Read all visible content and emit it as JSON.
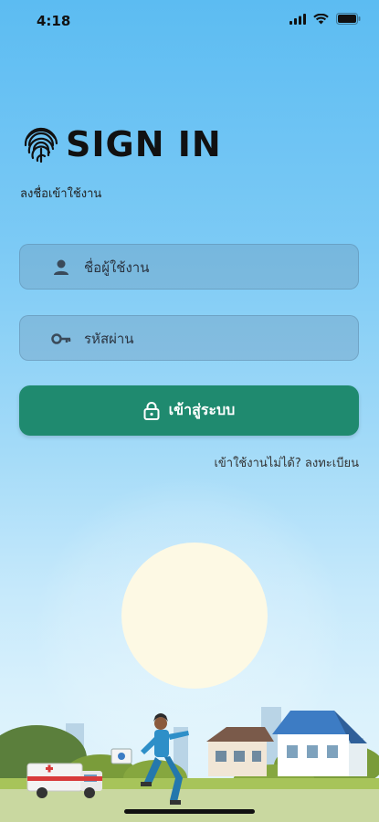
{
  "status_bar": {
    "time": "4:18"
  },
  "header": {
    "title": "SIGN IN",
    "subtitle": "ลงชื่อเข้าใช้งาน"
  },
  "form": {
    "username_placeholder": "ชื่อผู้ใช้งาน",
    "password_placeholder": "รหัสผ่าน",
    "submit_label": "เข้าสู่ระบบ"
  },
  "register": {
    "prompt": "เข้าใช้งานไม่ได้?",
    "link": "ลงทะเบียน"
  },
  "icons": {
    "user": "user-icon",
    "password": "key-icon",
    "submit": "lock-icon",
    "brand": "fingerprint-icon"
  },
  "colors": {
    "primary_button": "#1f8a6f",
    "sky_top": "#5cbcf2",
    "sun": "#fdf9e4"
  }
}
